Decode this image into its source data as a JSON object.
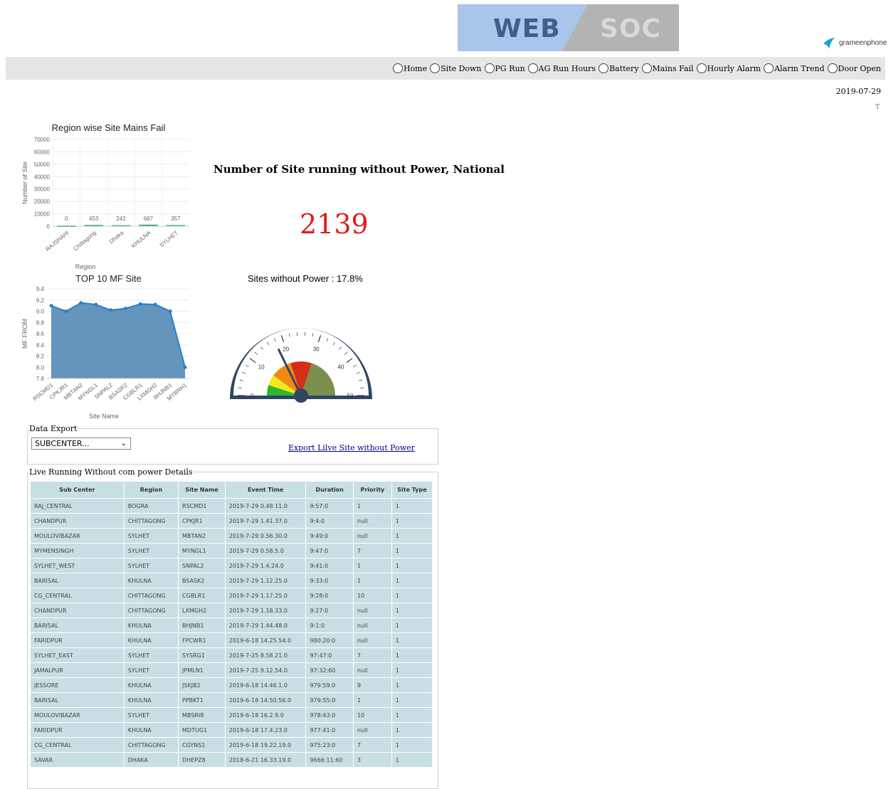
{
  "header": {
    "banner_left": "WEB",
    "banner_right": "SOC",
    "logo_text": "grameenphone"
  },
  "nav": {
    "items": [
      {
        "label": "Home"
      },
      {
        "label": "Site Down"
      },
      {
        "label": "PG Run"
      },
      {
        "label": "AG Run Hours"
      },
      {
        "label": "Battery"
      },
      {
        "label": "Mains Fail"
      },
      {
        "label": "Hourly Alarm"
      },
      {
        "label": "Alarm Trend"
      },
      {
        "label": "Door Open"
      }
    ]
  },
  "date": "2019-07-29",
  "corner_mark": "T",
  "summary": {
    "title": "Number of Site running without Power, National",
    "count": "2139",
    "gauge_title": "Sites without Power : 17.8%"
  },
  "data_export": {
    "legend": "Data Export",
    "select_value": "SUBCENTER...",
    "export_link": "Export Lilve Site without Power"
  },
  "details": {
    "legend": "Live Running Without com power Details",
    "columns": [
      "Sub Center",
      "Region",
      "Site Name",
      "Event Time",
      "Duration",
      "Priority",
      "Site Type"
    ],
    "rows": [
      [
        "RAJ_CENTRAL",
        "BOGRA",
        "RSCMD1",
        "2019-7-29 0.48.11.0",
        "9:57:0",
        "1",
        "1"
      ],
      [
        "CHANDPUR",
        "CHITTAGONG",
        "CPKJR1",
        "2019-7-29 1.41.37.0",
        "9:4:0",
        "null",
        "1"
      ],
      [
        "MOULOVIBAZAR",
        "SYLHET",
        "MBTAN2",
        "2019-7-29 0.56.30.0",
        "9:49:0",
        "null",
        "1"
      ],
      [
        "MYMENSINGH",
        "SYLHET",
        "MYNGL1",
        "2019-7-29 0.58.5.0",
        "9:47:0",
        "7",
        "1"
      ],
      [
        "SYLHET_WEST",
        "SYLHET",
        "SNPAL2",
        "2019-7-29 1.4.24.0",
        "9:41:0",
        "1",
        "1"
      ],
      [
        "BARISAL",
        "KHULNA",
        "BSASK2",
        "2019-7-29 1.12.25.0",
        "9:33:0",
        "1",
        "1"
      ],
      [
        "CG_CENTRAL",
        "CHITTAGONG",
        "CGBLR1",
        "2019-7-29 1.17.25.0",
        "9:28:0",
        "10",
        "1"
      ],
      [
        "CHANDPUR",
        "CHITTAGONG",
        "LXMGH2",
        "2019-7-29 1.18.33.0",
        "9:27:0",
        "null",
        "1"
      ],
      [
        "BARISAL",
        "KHULNA",
        "BHJNB1",
        "2019-7-29 1.44.48.0",
        "9:1:0",
        "null",
        "1"
      ],
      [
        "FARIDPUR",
        "KHULNA",
        "FPCWR1",
        "2019-6-18 14.25.54.0",
        "980:20:0",
        "null",
        "1"
      ],
      [
        "SYLHET_EAST",
        "SYLHET",
        "SYSRG1",
        "2019-7-25 8.58.21.0",
        "97:47:0",
        "7",
        "1"
      ],
      [
        "JAMALPUR",
        "SYLHET",
        "JPMLN1",
        "2019-7-25 9.12.54.0",
        "97:32:60",
        "null",
        "1"
      ],
      [
        "JESSORE",
        "KHULNA",
        "JSKJB2",
        "2019-6-18 14.46.1.0",
        "979:59:0",
        "9",
        "1"
      ],
      [
        "BARISAL",
        "KHULNA",
        "PPBKT1",
        "2019-6-18 14.50.56.0",
        "979:55:0",
        "1",
        "1"
      ],
      [
        "MOULOVIBAZAR",
        "SYLHET",
        "MBSRI8",
        "2019-6-18 16.2.9.0",
        "978:43:0",
        "10",
        "1"
      ],
      [
        "FARIDPUR",
        "KHULNA",
        "MDTUG1",
        "2019-6-18 17.4.23.0",
        "977:41:0",
        "null",
        "1"
      ],
      [
        "CG_CENTRAL",
        "CHITTAGONG",
        "CGYNS1",
        "2019-6-18 19.22.19.0",
        "975:23:0",
        "7",
        "1"
      ],
      [
        "SAVAR",
        "DHAKA",
        "DHEPZ8",
        "2018-6-21 16.33.19.0",
        "9666:11:60",
        "3",
        "1"
      ]
    ]
  },
  "chart_data": [
    {
      "type": "bar",
      "title": "Region wise Site Mains Fail",
      "xlabel": "Region",
      "ylabel": "Number of Site",
      "categories": [
        "RAJSHAHI",
        "Chittagong",
        "Dhaka",
        "KHULNA",
        "SYLHET"
      ],
      "values": [
        0,
        453,
        242,
        687,
        357
      ],
      "ylim": [
        0,
        70000
      ],
      "yticks": [
        0,
        10000,
        20000,
        30000,
        40000,
        50000,
        60000,
        70000
      ],
      "bar_color": "#2e9e8a",
      "grid": true
    },
    {
      "type": "area",
      "title": "TOP 10 MF Site",
      "xlabel": "Site Name",
      "ylabel": "MF FROM",
      "categories": [
        "RSCMD1",
        "CPKJR1",
        "MBTAN2",
        "MYNGL1",
        "SNPAL2",
        "BSASK2",
        "CGBLR1",
        "LXMGH2",
        "BHJNB1",
        "MYBRH1"
      ],
      "values": [
        9.1,
        9.0,
        9.15,
        9.12,
        9.02,
        9.05,
        9.13,
        9.12,
        9.0,
        8.0
      ],
      "ylim": [
        7.8,
        9.4
      ],
      "yticks": [
        7.8,
        8.0,
        8.2,
        8.4,
        8.6,
        8.8,
        9.0,
        9.2,
        9.4
      ],
      "fill_color": "#5b8fb9",
      "line_color": "#2a7fc9",
      "grid": true
    },
    {
      "type": "gauge",
      "title": "Sites without Power : 17.8%",
      "value": 17.8,
      "range": [
        0,
        50
      ],
      "tick_labels": [
        0,
        10,
        20,
        30,
        40,
        50
      ],
      "bands": [
        {
          "from": 0,
          "to": 5,
          "color": "#2fb52f"
        },
        {
          "from": 5,
          "to": 10,
          "color": "#f5e81a"
        },
        {
          "from": 10,
          "to": 20,
          "color": "#f08a12"
        },
        {
          "from": 20,
          "to": 30,
          "color": "#d42e18"
        },
        {
          "from": 30,
          "to": 50,
          "color": "#7d8f4c"
        }
      ]
    }
  ]
}
